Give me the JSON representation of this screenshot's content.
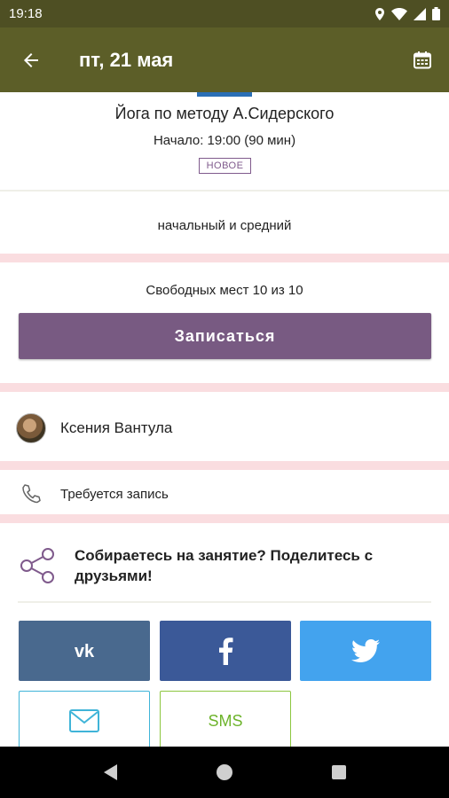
{
  "statusbar": {
    "time": "19:18"
  },
  "appbar": {
    "title": "пт, 21 мая",
    "back_icon": "arrow-left-icon",
    "calendar_icon": "calendar-icon"
  },
  "class": {
    "title": "Йога по методу А.Сидерского",
    "time": "Начало: 19:00 (90 мин)",
    "badge": "НОВОЕ",
    "level": "начальный и средний",
    "seats": "Свободных мест 10 из 10",
    "signup_label": "Записаться"
  },
  "teacher": {
    "name": "Ксения Вантула"
  },
  "booking": {
    "text": "Требуется запись",
    "icon": "phone-icon"
  },
  "share": {
    "text": "Собираетесь на занятие? Поделитесь с друзьями!",
    "icon": "share-icon",
    "buttons": {
      "vk_icon": "vk-icon",
      "facebook_icon": "facebook-icon",
      "twitter_icon": "twitter-icon",
      "email_icon": "mail-icon",
      "sms_label": "SMS"
    }
  },
  "colors": {
    "appbar": "#5c5e28",
    "statusbar": "#4e4f23",
    "accent": "#785a82",
    "separator": "#fadde0",
    "vk": "#49698e",
    "facebook": "#3b5998",
    "twitter": "#43a3ee",
    "email_border": "#3fb4d8",
    "sms_border": "#8cc63f"
  }
}
